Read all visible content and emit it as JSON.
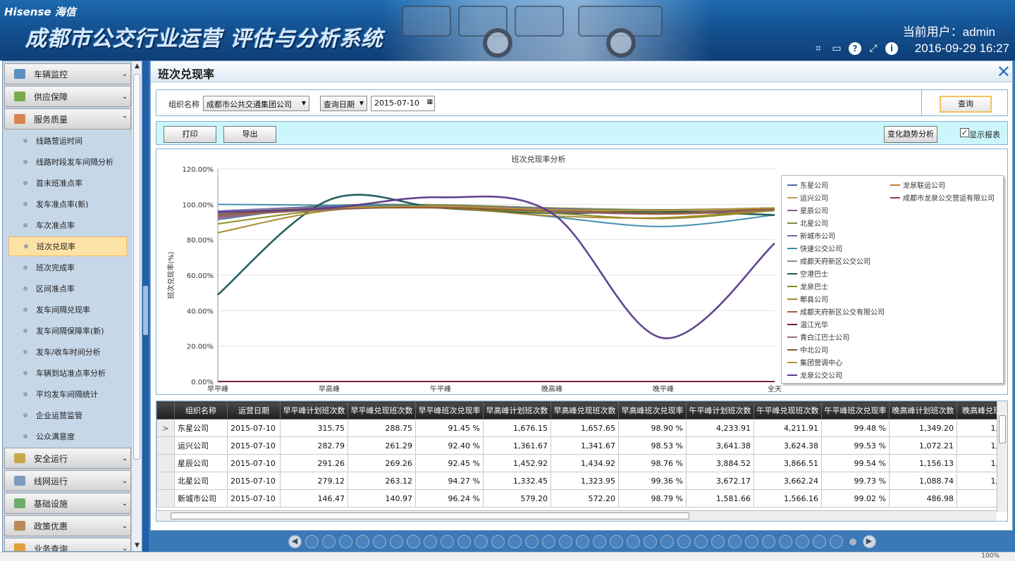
{
  "header": {
    "logo": "Hisense 海信",
    "system_title": "成都市公交行业运营 评估与分析系统",
    "user_label": "当前用户：admin",
    "datetime": "2016-09-29 16:27",
    "tool_icons": [
      "crop-icon",
      "keyboard-icon",
      "help-icon",
      "exit-icon",
      "info-icon"
    ]
  },
  "sidebar": {
    "groups": [
      {
        "label": "车辆监控",
        "icon": "bus-monitor-icon",
        "color": "#5d8fbf"
      },
      {
        "label": "供应保障",
        "icon": "supply-icon",
        "color": "#7aab4a"
      },
      {
        "label": "服务质量",
        "icon": "service-icon",
        "color": "#d98552"
      }
    ],
    "items": [
      "线路营运时间",
      "线路时段发车间隔分析",
      "首末班准点率",
      "发车准点率(新)",
      "车次准点率",
      "班次兑现率",
      "班次完成率",
      "区间准点率",
      "发车间隔兑现率",
      "发车间隔保障率(新)",
      "发车/收车时间分析",
      "车辆到站准点率分析",
      "平均发车间隔统计",
      "企业运营监管",
      "公众满意度"
    ],
    "active_index": 5,
    "bottom_groups": [
      {
        "label": "安全运行",
        "icon": "safety-icon",
        "color": "#c9a64a"
      },
      {
        "label": "线网运行",
        "icon": "network-icon",
        "color": "#7d9cbf"
      },
      {
        "label": "基础设施",
        "icon": "infra-icon",
        "color": "#6fae6a"
      },
      {
        "label": "政策优惠",
        "icon": "policy-icon",
        "color": "#b88a5a"
      },
      {
        "label": "业务查询",
        "icon": "query-icon",
        "color": "#e0a040"
      }
    ]
  },
  "panel": {
    "title": "班次兑现率"
  },
  "query": {
    "org_label": "组织名称",
    "org_value": "成都市公共交通集团公司",
    "date_type_value": "查询日期",
    "date_value": "2015-07-10",
    "query_button": "查询"
  },
  "toolbar": {
    "print_button": "打印",
    "export_button": "导出",
    "trend_button": "变化趋势分析",
    "show_report_label": "显示报表",
    "show_report_checked": true
  },
  "chart_data": {
    "type": "line",
    "title": "班次兑现率分析",
    "xlabel": "",
    "ylabel": "班次兑现率(%)",
    "categories": [
      "早平峰",
      "早高峰",
      "午平峰",
      "晚高峰",
      "晚平峰",
      "全天"
    ],
    "ylim": [
      0,
      120
    ],
    "y_ticks": [
      "0.00%",
      "20.00%",
      "40.00%",
      "60.00%",
      "80.00%",
      "100.00%",
      "120.00%"
    ],
    "grid": true,
    "legend_position": "right",
    "series": [
      {
        "name": "东星公司",
        "color": "#4a6a9a",
        "values": [
          91.45,
          98.9,
          99.48,
          97.5,
          96.0,
          97.5
        ]
      },
      {
        "name": "龙泉联运公司",
        "color": "#c0782a",
        "values": [
          93.0,
          97.5,
          99.0,
          96.0,
          94.5,
          96.5
        ]
      },
      {
        "name": "运兴公司",
        "color": "#c89a5a",
        "values": [
          92.4,
          98.53,
          99.53,
          97.0,
          95.5,
          97.0
        ]
      },
      {
        "name": "成都市龙泉公交营运有限公司",
        "color": "#9a3a4a",
        "values": [
          0,
          0,
          0,
          0,
          0,
          0
        ]
      },
      {
        "name": "星辰公司",
        "color": "#8a5a8a",
        "values": [
          92.45,
          98.76,
          99.54,
          97.5,
          96.5,
          98.0
        ]
      },
      {
        "name": "北星公司",
        "color": "#7a8a4a",
        "values": [
          94.27,
          99.36,
          99.73,
          98.0,
          97.0,
          98.0
        ]
      },
      {
        "name": "新城市公司",
        "color": "#6a6aaa",
        "values": [
          96.24,
          98.79,
          99.02,
          97.5,
          96.0,
          97.5
        ]
      },
      {
        "name": "快速公交公司",
        "color": "#3a8aaa",
        "values": [
          100.0,
          99.5,
          99.0,
          93.0,
          87.5,
          94.0
        ]
      },
      {
        "name": "成都天府新区公交公司",
        "color": "#8a8a9a",
        "values": [
          95.0,
          98.0,
          98.5,
          97.0,
          96.0,
          97.0
        ]
      },
      {
        "name": "空港巴士",
        "color": "#1a5a5a",
        "values": [
          49.0,
          102.5,
          98.0,
          95.0,
          96.0,
          94.0
        ]
      },
      {
        "name": "龙泉巴士",
        "color": "#8a8a1a",
        "values": [
          89.0,
          97.0,
          98.5,
          95.0,
          92.0,
          96.5
        ]
      },
      {
        "name": "郫县公司",
        "color": "#a8862a",
        "values": [
          84.0,
          96.5,
          98.0,
          93.5,
          92.5,
          97.0
        ]
      },
      {
        "name": "成都天府新区公交有限公司",
        "color": "#a05a3a",
        "values": [
          0,
          0,
          0,
          0,
          0,
          0
        ]
      },
      {
        "name": "温江光华",
        "color": "#7a1a3a",
        "values": [
          0,
          0,
          0,
          0,
          0,
          0
        ]
      },
      {
        "name": "青白江巴士公司",
        "color": "#9a6a8a",
        "values": [
          93.5,
          97.0,
          98.5,
          96.0,
          94.5,
          97.0
        ]
      },
      {
        "name": "中北公司",
        "color": "#8a5a2a",
        "values": [
          94.0,
          97.5,
          98.0,
          96.5,
          95.0,
          97.5
        ]
      },
      {
        "name": "集团营调中心",
        "color": "#b8923a",
        "values": [
          95.5,
          98.0,
          99.0,
          97.0,
          96.5,
          98.0
        ]
      },
      {
        "name": "龙泉公交公司",
        "color": "#5a3a8a",
        "values": [
          95.5,
          98.0,
          104.0,
          95.0,
          24.5,
          78.0
        ]
      }
    ]
  },
  "table": {
    "columns": [
      "组织名称",
      "运营日期",
      "早平峰计划班次数",
      "早平峰兑现班次数",
      "早平峰班次兑现率",
      "早高峰计划班次数",
      "早高峰兑现班次数",
      "早高峰班次兑现率",
      "午平峰计划班次数",
      "午平峰兑现班次数",
      "午平峰班次兑现率",
      "晚高峰计划班次数",
      "晚高峰兑现"
    ],
    "rows": [
      [
        "东星公司",
        "2015-07-10",
        "315.75",
        "288.75",
        "91.45 %",
        "1,676.15",
        "1,657.65",
        "98.90 %",
        "4,233.91",
        "4,211.91",
        "99.48 %",
        "1,349.20",
        "1,3"
      ],
      [
        "运兴公司",
        "2015-07-10",
        "282.79",
        "261.29",
        "92.40 %",
        "1,361.67",
        "1,341.67",
        "98.53 %",
        "3,641.38",
        "3,624.38",
        "99.53 %",
        "1,072.21",
        "1,0"
      ],
      [
        "星辰公司",
        "2015-07-10",
        "291.26",
        "269.26",
        "92.45 %",
        "1,452.92",
        "1,434.92",
        "98.76 %",
        "3,884.52",
        "3,866.51",
        "99.54 %",
        "1,156.13",
        "1,1"
      ],
      [
        "北星公司",
        "2015-07-10",
        "279.12",
        "263.12",
        "94.27 %",
        "1,332.45",
        "1,323.95",
        "99.36 %",
        "3,672.17",
        "3,662.24",
        "99.73 %",
        "1,088.74",
        "1,0"
      ],
      [
        "新城市公司",
        "2015-07-10",
        "146.47",
        "140.97",
        "96.24 %",
        "579.20",
        "572.20",
        "98.79 %",
        "1,581.66",
        "1,566.16",
        "99.02 %",
        "486.98",
        "4"
      ]
    ],
    "current_row_marker": ">"
  },
  "pager": {
    "prev": "◀",
    "next": "▶",
    "page_count": 33,
    "current_page": 33
  },
  "statusbar": {
    "zoom": "100%"
  }
}
